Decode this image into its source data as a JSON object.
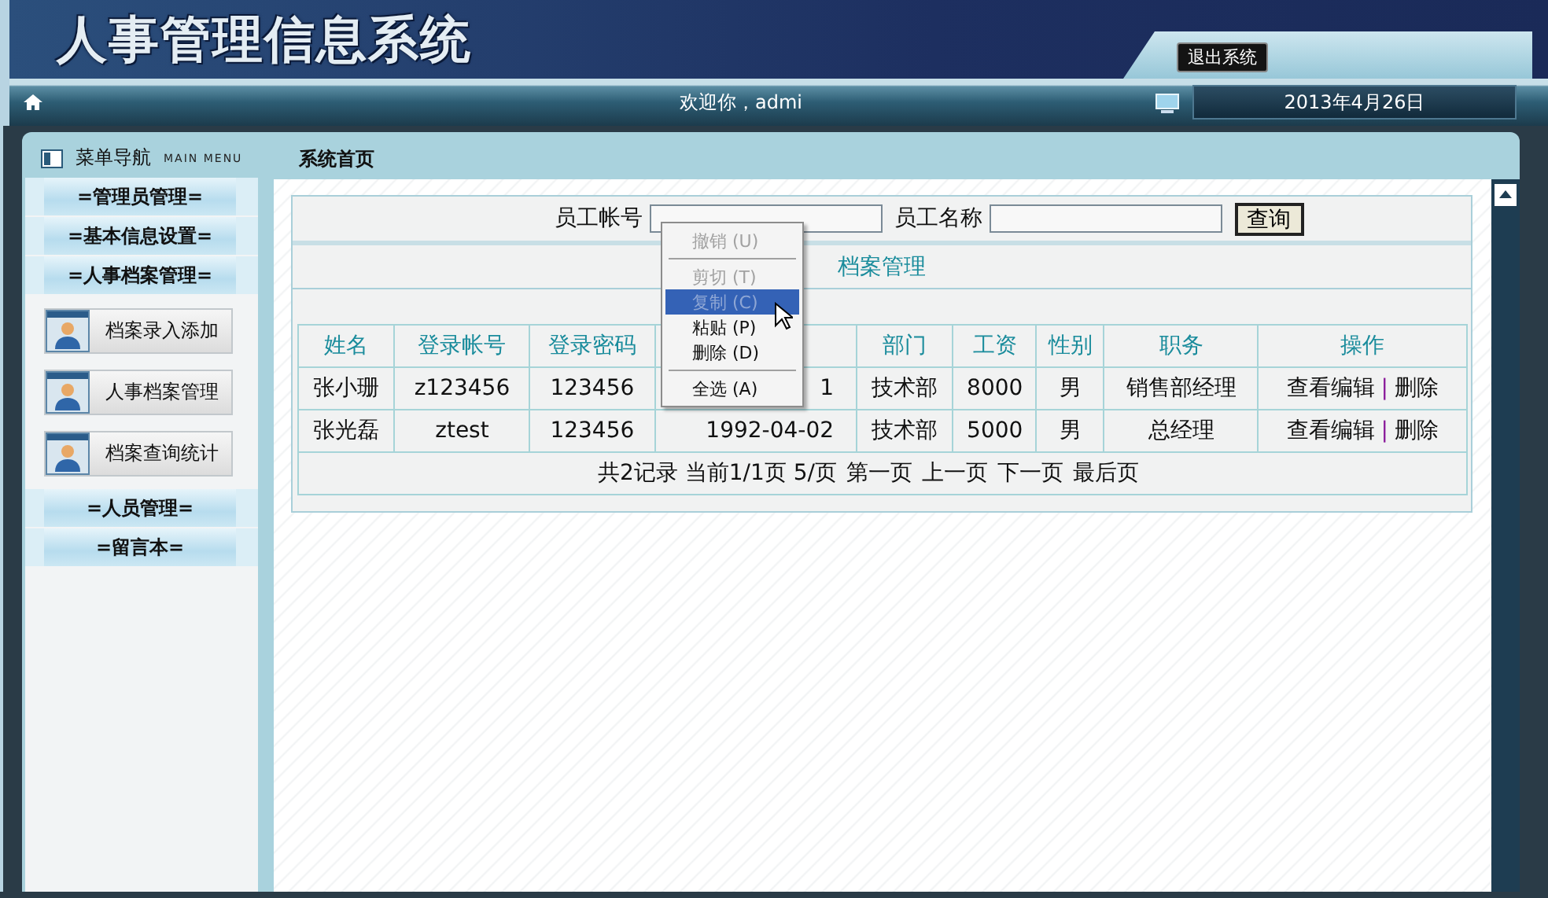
{
  "header": {
    "title": "人事管理信息系统",
    "logout_button": "退出系统"
  },
  "navbar": {
    "welcome": "欢迎你，admi",
    "date": "2013年4月26日"
  },
  "sidebar": {
    "title": "菜单导航",
    "subtitle": "MAIN MENU",
    "groups": [
      {
        "label": "=管理员管理="
      },
      {
        "label": "=基本信息设置="
      },
      {
        "label": "=人事档案管理=",
        "items": [
          "档案录入添加",
          "人事档案管理",
          "档案查询统计"
        ]
      },
      {
        "label": "=人员管理="
      },
      {
        "label": "=留言本="
      }
    ]
  },
  "breadcrumb": "系统首页",
  "search": {
    "fields": [
      {
        "label": "员工帐号"
      },
      {
        "label": "员工名称"
      }
    ],
    "button": "查询"
  },
  "panel_title": "档案管理",
  "table": {
    "columns": [
      {
        "label": "姓名"
      },
      {
        "label": "登录帐号"
      },
      {
        "label": "登录密码"
      },
      {},
      {
        "label": "部门"
      },
      {
        "label": "工资"
      },
      {
        "label": "性别"
      },
      {
        "label": "职务"
      },
      {
        "label": "操作"
      }
    ],
    "rows": [
      {
        "cells": [
          "张小珊",
          "z123456",
          "123456",
          "1",
          "技术部",
          "8000",
          "男",
          "销售部经理"
        ],
        "actions": [
          "查看编辑",
          "删除"
        ],
        "separator": "|"
      },
      {
        "cells": [
          "张光磊",
          "ztest",
          "123456",
          "1992-04-02",
          "技术部",
          "5000",
          "男",
          "总经理"
        ],
        "actions": [
          "查看编辑",
          "删除"
        ],
        "separator": "|"
      }
    ],
    "summary": "共2记录 当前1/1页 5/页",
    "pager": [
      "第一页",
      "上一页",
      "下一页",
      "最后页"
    ]
  },
  "context_menu": [
    {
      "kind": "item",
      "label": "撤销 (U)",
      "disabled": true,
      "selected": false
    },
    {
      "kind": "separator"
    },
    {
      "kind": "item",
      "label": "剪切 (T)",
      "disabled": true,
      "selected": false
    },
    {
      "kind": "item",
      "label": "复制 (C)",
      "disabled": true,
      "selected": true
    },
    {
      "kind": "item",
      "label": "粘贴 (P)",
      "disabled": false,
      "selected": false
    },
    {
      "kind": "item",
      "label": "删除 (D)",
      "disabled": false,
      "selected": false
    },
    {
      "kind": "separator"
    },
    {
      "kind": "item",
      "label": "全选 (A)",
      "disabled": false,
      "selected": false
    }
  ]
}
